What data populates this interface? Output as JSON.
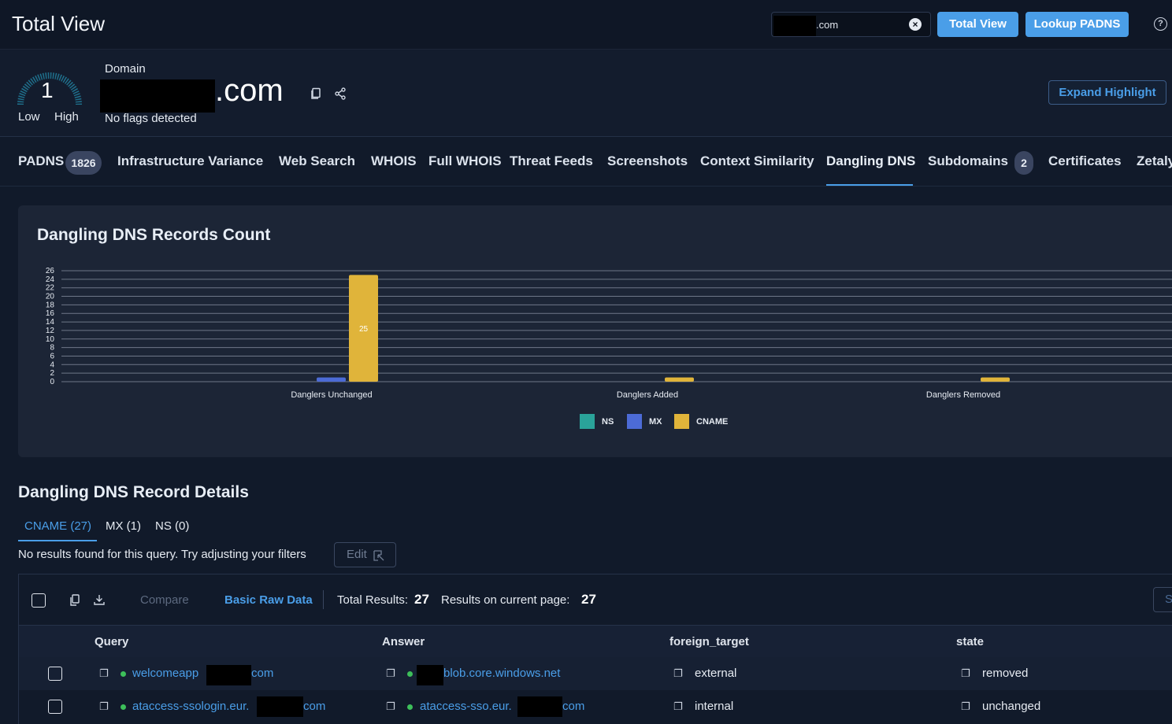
{
  "header": {
    "title": "Total View",
    "search_value": ".com",
    "btn_total_view": "Total View",
    "btn_lookup": "Lookup PADNS",
    "help": "?"
  },
  "domain": {
    "score": "1",
    "low": "Low",
    "high": "High",
    "label": "Domain",
    "name_suffix": ".com",
    "flags": "No flags detected",
    "expand": "Expand Highlight"
  },
  "tabs": [
    {
      "label": "PADNS",
      "badge": "1826"
    },
    {
      "label": "Infrastructure Variance"
    },
    {
      "label": "Web Search"
    },
    {
      "label": "WHOIS"
    },
    {
      "label": "Full WHOIS"
    },
    {
      "label": "Threat Feeds"
    },
    {
      "label": "Screenshots"
    },
    {
      "label": "Context Similarity"
    },
    {
      "label": "Dangling DNS"
    },
    {
      "label": "Subdomains",
      "badge": "2"
    },
    {
      "label": "Certificates"
    },
    {
      "label": "Zetaly"
    }
  ],
  "chart": {
    "title": "Dangling DNS Records Count"
  },
  "chart_data": {
    "type": "bar",
    "categories": [
      "Danglers Unchanged",
      "Danglers Added",
      "Danglers Removed"
    ],
    "series": [
      {
        "name": "NS",
        "color": "#2aa39a",
        "values": [
          0,
          0,
          0
        ]
      },
      {
        "name": "MX",
        "color": "#4c6bd6",
        "values": [
          1,
          0,
          0
        ]
      },
      {
        "name": "CNAME",
        "color": "#e0b43a",
        "values": [
          25,
          1,
          1
        ]
      }
    ],
    "data_labels": [
      "25"
    ],
    "yticks": [
      "0",
      "2",
      "4",
      "6",
      "8",
      "10",
      "12",
      "14",
      "16",
      "18",
      "20",
      "22",
      "24",
      "26"
    ],
    "ylim": [
      0,
      26
    ],
    "legend": "bottom-center",
    "grid": true
  },
  "details": {
    "title": "Dangling DNS Record Details",
    "subtabs": [
      "CNAME (27)",
      "MX (1)",
      "NS (0)"
    ],
    "no_results": "No results found for this query. Try adjusting your filters",
    "edit": "Edit",
    "compare": "Compare",
    "basic_raw": "Basic Raw Data",
    "total_label": "Total Results:",
    "total_value": "27",
    "page_label": "Results on current page:",
    "page_value": "27",
    "right_btn": "S",
    "columns": [
      "Query",
      "Answer",
      "foreign_target",
      "state"
    ],
    "rows": [
      {
        "query_a": "welcomeapp",
        "query_b": "com",
        "answer_a": "",
        "answer_b": "blob.core.windows.net",
        "foreign_target": "external",
        "state": "removed"
      },
      {
        "query_a": "ataccess-ssologin.eur.",
        "query_b": "com",
        "answer_a": "ataccess-sso.eur.",
        "answer_b": "com",
        "foreign_target": "internal",
        "state": "unchanged"
      }
    ]
  }
}
